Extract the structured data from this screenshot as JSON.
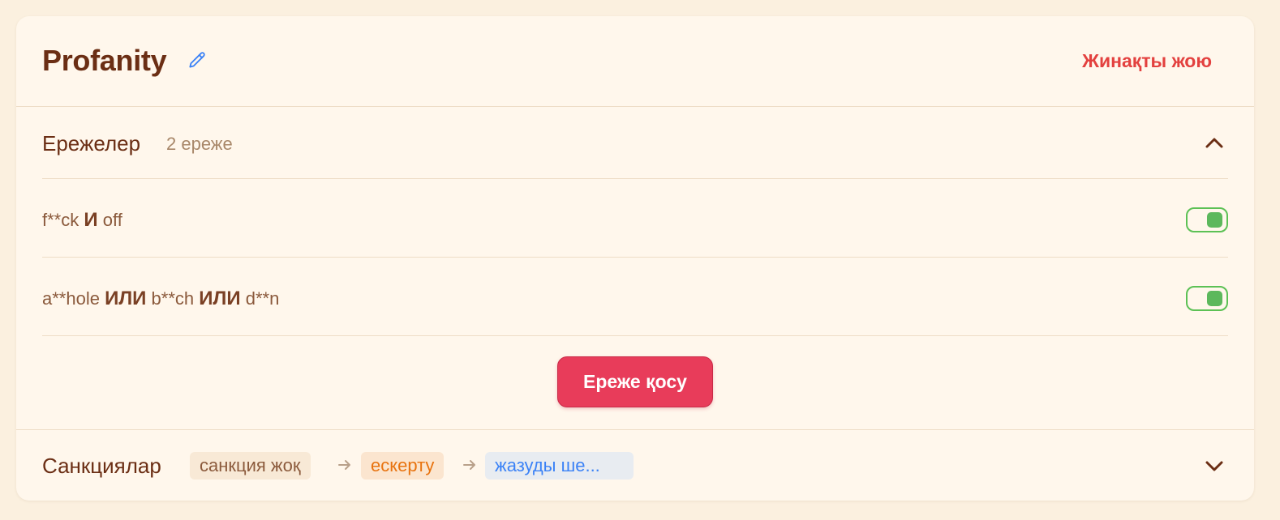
{
  "header": {
    "title": "Profanity",
    "delete_label": "Жинақты жою"
  },
  "rules_section": {
    "title": "Ережелер",
    "count": "2 ереже",
    "expanded": true,
    "rules": [
      {
        "parts": [
          "f**ck",
          "И",
          "off"
        ],
        "enabled": true
      },
      {
        "parts": [
          "a**hole",
          "ИЛИ",
          "b**ch",
          "ИЛИ",
          "d**n"
        ],
        "enabled": true
      }
    ],
    "add_button_label": "Ереже қосу"
  },
  "sanctions_section": {
    "title": "Санкциялар",
    "expanded": false,
    "steps": [
      {
        "label": "санкция жоқ",
        "color": "#8b5a3c",
        "bg": "#f8e9d6"
      },
      {
        "label": "ескерту",
        "color": "#e8730f",
        "bg": "#fbe5cf"
      },
      {
        "label": "жазуды ше...",
        "color": "#3b82f6",
        "bg": "#e8ecf1"
      }
    ]
  },
  "colors": {
    "accent": "#e83c5a",
    "danger_text": "#e3413f",
    "toggle_on": "#5cb85c",
    "title": "#6b2e14"
  }
}
